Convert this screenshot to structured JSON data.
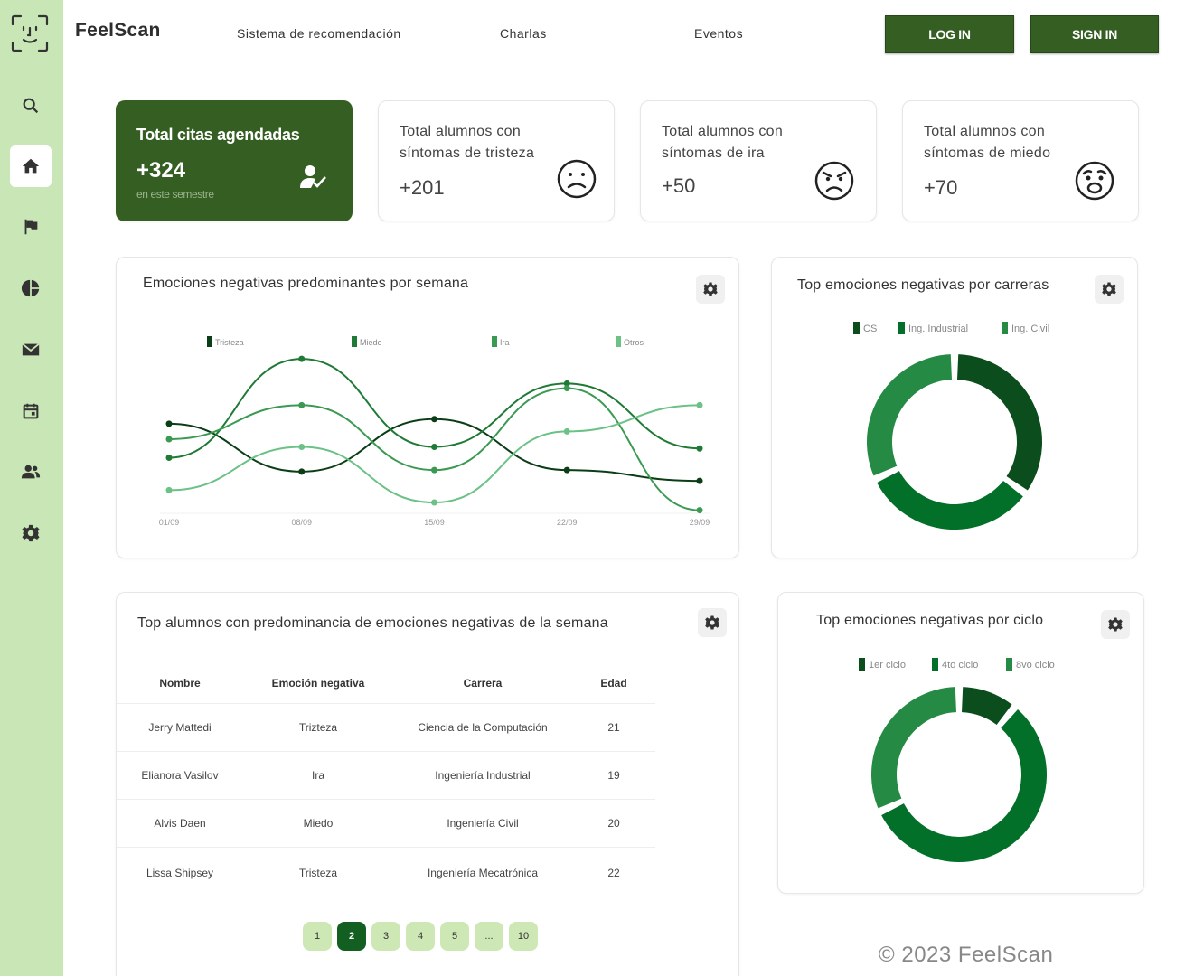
{
  "brand": "FeelScan",
  "nav": [
    {
      "label": "Sistema de recomendación"
    },
    {
      "label": "Charlas"
    },
    {
      "label": "Eventos"
    }
  ],
  "auth": {
    "login": "LOG IN",
    "signin": "SIGN IN"
  },
  "sidebar": {
    "items": [
      {
        "icon": "search-icon"
      },
      {
        "icon": "home-icon",
        "active": true
      },
      {
        "icon": "flag-icon"
      },
      {
        "icon": "pie-chart-icon"
      },
      {
        "icon": "mail-icon"
      },
      {
        "icon": "calendar-icon"
      },
      {
        "icon": "people-icon"
      },
      {
        "icon": "gear-icon"
      }
    ]
  },
  "kpis": {
    "citas": {
      "title": "Total citas agendadas",
      "value": "+324",
      "subtitle": "en este semestre",
      "icon": "user-check-icon"
    },
    "tristeza": {
      "title1": "Total  alumnos con",
      "title2": "síntomas de tristeza",
      "value": "+201",
      "icon": "sad-face-icon"
    },
    "ira": {
      "title1": "Total  alumnos con",
      "title2": "síntomas de ira",
      "value": "+50",
      "icon": "angry-face-icon"
    },
    "miedo": {
      "title1": "Total  alumnos con",
      "title2": "síntomas de miedo",
      "value": "+70",
      "icon": "fear-face-icon"
    }
  },
  "line_card": {
    "title": "Emociones negativas predominantes por semana"
  },
  "carrera_card": {
    "title": "Top emociones negativas por carreras"
  },
  "ciclo_card": {
    "title": "Top emociones negativas por ciclo"
  },
  "table_card": {
    "title": "Top alumnos con predominancia de emociones negativas de la semana",
    "headers": [
      "Nombre",
      "Emoción negativa",
      "Carrera",
      "Edad"
    ],
    "rows": [
      [
        "Jerry Mattedi",
        "Trizteza",
        "Ciencia de la Computación",
        "21"
      ],
      [
        "Elianora Vasilov",
        "Ira",
        "Ingeniería Industrial",
        "19"
      ],
      [
        "Alvis Daen",
        "Miedo",
        "Ingeniería Civil",
        "20"
      ],
      [
        "Lissa Shipsey",
        "Tristeza",
        "Ingeniería Mecatrónica",
        "22"
      ]
    ],
    "pages": [
      "1",
      "2",
      "3",
      "4",
      "5",
      "...",
      "10"
    ],
    "current_page": "2"
  },
  "footer": "© 2023  FeelScan",
  "colors": {
    "sidebar": "#c8e6b6",
    "dark_green": "#355e22",
    "page_active": "#135f22",
    "page": "#cde7b5"
  },
  "chart_data": [
    {
      "type": "line",
      "categories": [
        "01/09",
        "08/09",
        "15/09",
        "22/09",
        "29/09"
      ],
      "series": [
        {
          "name": "Tristeza",
          "color": "#0b3d16",
          "values": [
            58,
            27,
            61,
            28,
            21
          ]
        },
        {
          "name": "Miedo",
          "color": "#1e7a35",
          "values": [
            36,
            100,
            43,
            84,
            42
          ]
        },
        {
          "name": "Ira",
          "color": "#3a9a52",
          "values": [
            48,
            70,
            28,
            81,
            2
          ]
        },
        {
          "name": "Otros",
          "color": "#6cc286",
          "values": [
            15,
            43,
            7,
            53,
            70
          ]
        }
      ],
      "ylim": [
        0,
        110
      ],
      "legend": "top",
      "grid": false
    },
    {
      "type": "pie",
      "donut": true,
      "categories": [
        "CS",
        "Ing. Industrial",
        "Ing. Civil"
      ],
      "values": [
        35,
        33,
        32
      ],
      "colors": [
        "#0b4d1c",
        "#027028",
        "#248a44"
      ],
      "legend": "top"
    },
    {
      "type": "pie",
      "donut": true,
      "categories": [
        "1er ciclo",
        "4to ciclo",
        "8vo ciclo"
      ],
      "values": [
        11,
        57,
        32
      ],
      "colors": [
        "#0b4d1c",
        "#027028",
        "#248a44"
      ],
      "legend": "top"
    }
  ]
}
